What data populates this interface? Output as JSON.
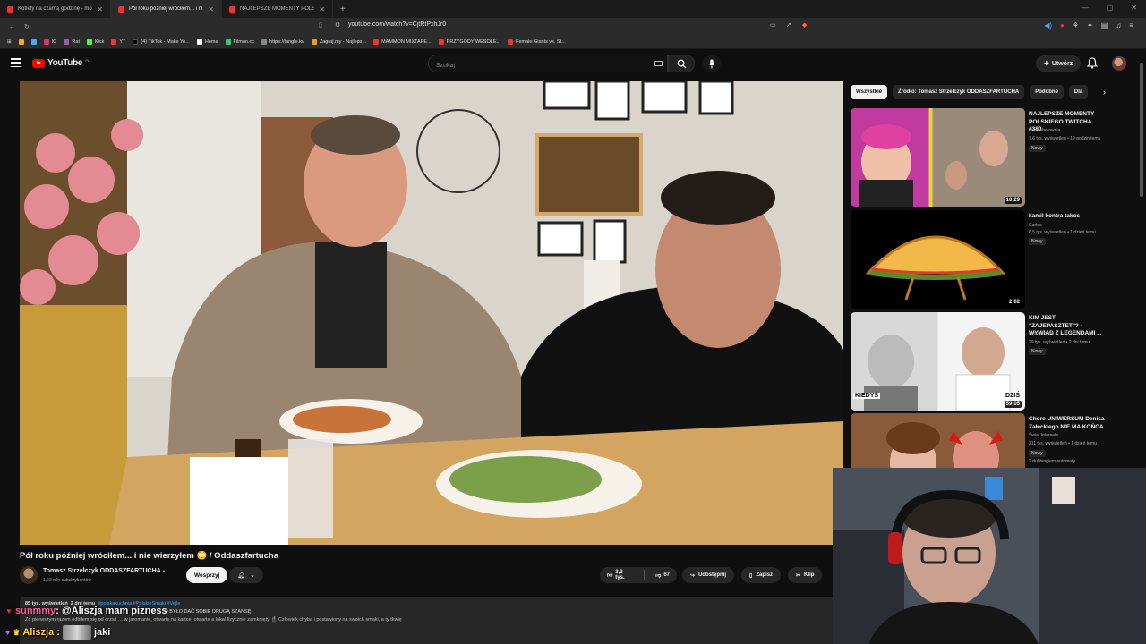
{
  "browser": {
    "tabs": [
      {
        "title": "Kotlety na czarną godzinę - mogą st"
      },
      {
        "title": "Pół roku później wróciłem... i ni"
      },
      {
        "title": "NAJLEPSZE MOMENTY POLSKIEGO T"
      }
    ],
    "url": "youtube.com/watch?v=CjtRtPxhJr0",
    "bookmarks": [
      "IG",
      "Rat",
      "Kick",
      "YT",
      "(4) TikTok - Make Yo...",
      "Home",
      "Filman.cc",
      "https://tangle.io/",
      "Zagraj.my - Najleps...",
      "MAMMON MIXTAPE...",
      "PRZYGODY WESOŁE...",
      "Female Giants vs. St..."
    ]
  },
  "youtube": {
    "logo_text": "YouTube",
    "country": "PL",
    "search_placeholder": "Szukaj",
    "create_label": "Utwórz"
  },
  "video": {
    "title": "Pół roku później wróciłem... i nie wierzyłem 😳 / Oddaszfartucha",
    "channel_name": "Tomasz Strzelczyk ODDASZFARTUCHA",
    "verified_mark": "●",
    "subscribers": "1,62 mln subskrybentów",
    "support_label": "Wesprzyj",
    "likes": "3,3 tys.",
    "dislikes": "67",
    "share_label": "Udostępnij",
    "save_label": "Zapisz",
    "clip_label": "Klip",
    "views": "85 tys. wyświetleń",
    "age": "2 dni temu",
    "tags": "#polskakuchnia #PolskieSmaki #Vejle",
    "desc_line1": "…O BYŁO DAĆ SOBIE DRUGĄ SZANSĘ.",
    "desc_line2": "Zo pierwszym razem odbiłem się od drzwi … w jaromanie, otwarte na kartce, otwarte a lokal fizycznie zamknięty 🍴 Człowiek chyba i postawiony na swoich smaki, a ty tkwię"
  },
  "chat": [
    {
      "user": "sunmmy",
      "message": ": @Aliszja mam pizness"
    },
    {
      "user": "Aliszja",
      "message": "jaki"
    }
  ],
  "sidebar": {
    "chips": [
      "Wszystkie",
      "Źródło: Tomasz Strzelczyk ODDASZFARTUCHA",
      "Podobne",
      "Dla"
    ],
    "recommendations": [
      {
        "title": "NAJLEPSZE MOMENTY POLSKIEGO TWITCHA #380",
        "channel": "twitchshotownia",
        "meta": "7,6 tys. wyświetleń • 19 godzin temu",
        "badge": "Nowy",
        "duration": "10:29"
      },
      {
        "title": "kamil kontra takos",
        "channel": "Carloo",
        "meta": "6,5 tys. wyświetleń • 1 dzień temu",
        "badge": "Nowy",
        "duration": "2:02"
      },
      {
        "title": "KIM JEST \"ZAJEPASZTET\"? - WYWIAD Z LEGENDAMI ...",
        "channel": "DOMINEWS",
        "meta": "29 tys. wyświetleń • 2 dni temu",
        "badge": "Nowy",
        "duration": "59:05",
        "thumb_left": "KIEDYŚ",
        "thumb_right": "DZIŚ"
      },
      {
        "title": "Chore UNIWERSUM Denisa Załęckiego NIE MA KOŃCA",
        "channel": "Świat Internetu",
        "meta": "211 tys. wyświetleń • 1 dzień temu",
        "badge": "Nowy",
        "extra": "2 dubbingiem automaty..."
      }
    ]
  },
  "colors": {
    "bg": "#0f0f0f",
    "accent_red": "#ff0000",
    "chip_bg": "#272727",
    "link_blue": "#3ea6ff"
  }
}
